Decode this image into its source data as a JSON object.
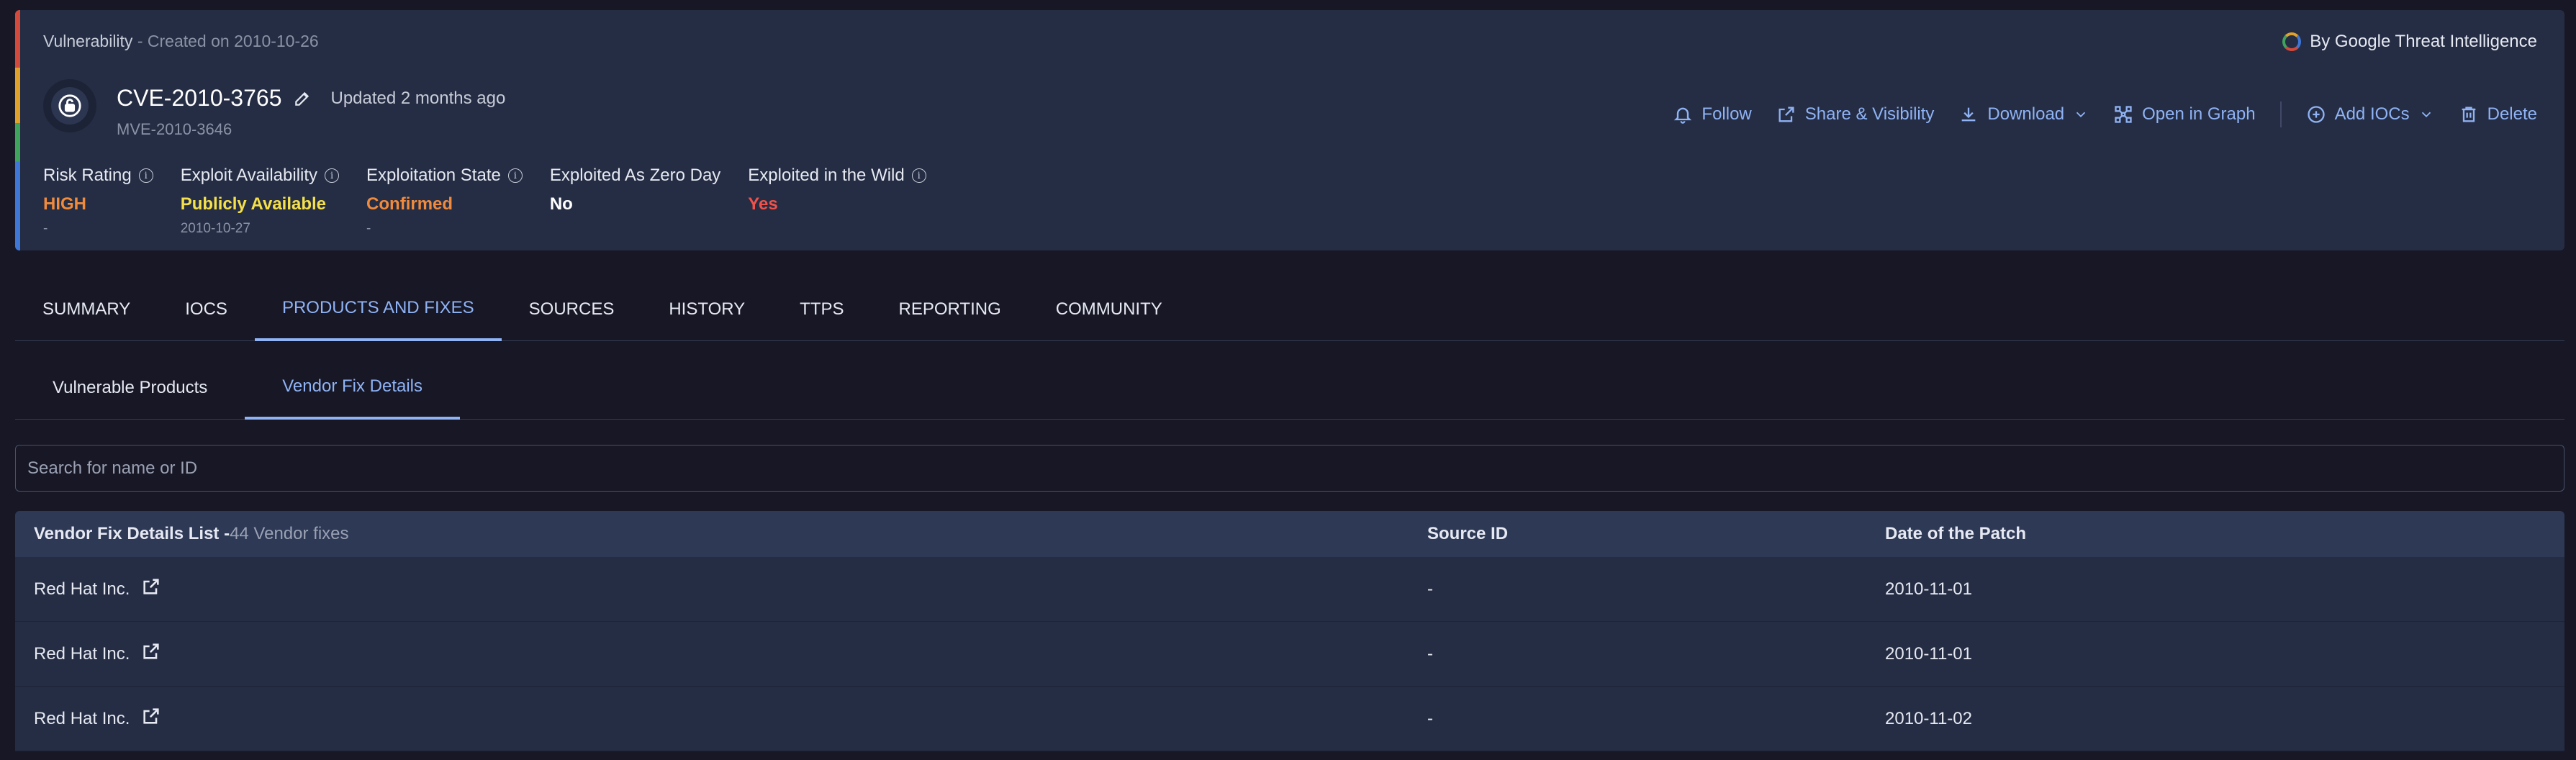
{
  "header": {
    "type_label": "Vulnerability",
    "created": " - Created on 2010-10-26",
    "cve_id": "CVE-2010-3765",
    "updated": "Updated 2 months ago",
    "mve_id": "MVE-2010-3646",
    "attribution": "By Google Threat Intelligence",
    "actions": {
      "follow": "Follow",
      "share": "Share & Visibility",
      "download": "Download",
      "open_graph": "Open in Graph",
      "add_iocs": "Add IOCs",
      "delete": "Delete"
    },
    "metrics": [
      {
        "label": "Risk Rating",
        "value": "HIGH",
        "sub": "-",
        "color": "#f08a3c",
        "info": true
      },
      {
        "label": "Exploit Availability",
        "value": "Publicly Available",
        "sub": "2010-10-27",
        "color": "#f5e04a",
        "info": true
      },
      {
        "label": "Exploitation State",
        "value": "Confirmed",
        "sub": "-",
        "color": "#f08a3c",
        "info": true
      },
      {
        "label": "Exploited As Zero Day",
        "value": "No",
        "sub": "",
        "color": "#ffffff",
        "info": false
      },
      {
        "label": "Exploited in the Wild",
        "value": "Yes",
        "sub": "",
        "color": "#f0524a",
        "info": true
      }
    ]
  },
  "tabs": [
    "SUMMARY",
    "IOCS",
    "PRODUCTS AND FIXES",
    "SOURCES",
    "HISTORY",
    "TTPS",
    "REPORTING",
    "COMMUNITY"
  ],
  "active_tab": "PRODUCTS AND FIXES",
  "subtabs": [
    "Vulnerable Products",
    "Vendor Fix Details"
  ],
  "active_subtab": "Vendor Fix Details",
  "search": {
    "placeholder": "Search for name or ID",
    "value": ""
  },
  "table": {
    "title": "Vendor Fix Details List -",
    "count": "44 Vendor fixes",
    "columns": [
      "Source ID",
      "Date of the Patch"
    ],
    "rows": [
      {
        "vendor": "Red Hat Inc.",
        "source_id": "-",
        "date": "2010-11-01"
      },
      {
        "vendor": "Red Hat Inc.",
        "source_id": "-",
        "date": "2010-11-01"
      },
      {
        "vendor": "Red Hat Inc.",
        "source_id": "-",
        "date": "2010-11-02"
      }
    ]
  },
  "colors": {
    "accent": "#8fb3f5",
    "background": "#171725",
    "card": "#252d44"
  }
}
